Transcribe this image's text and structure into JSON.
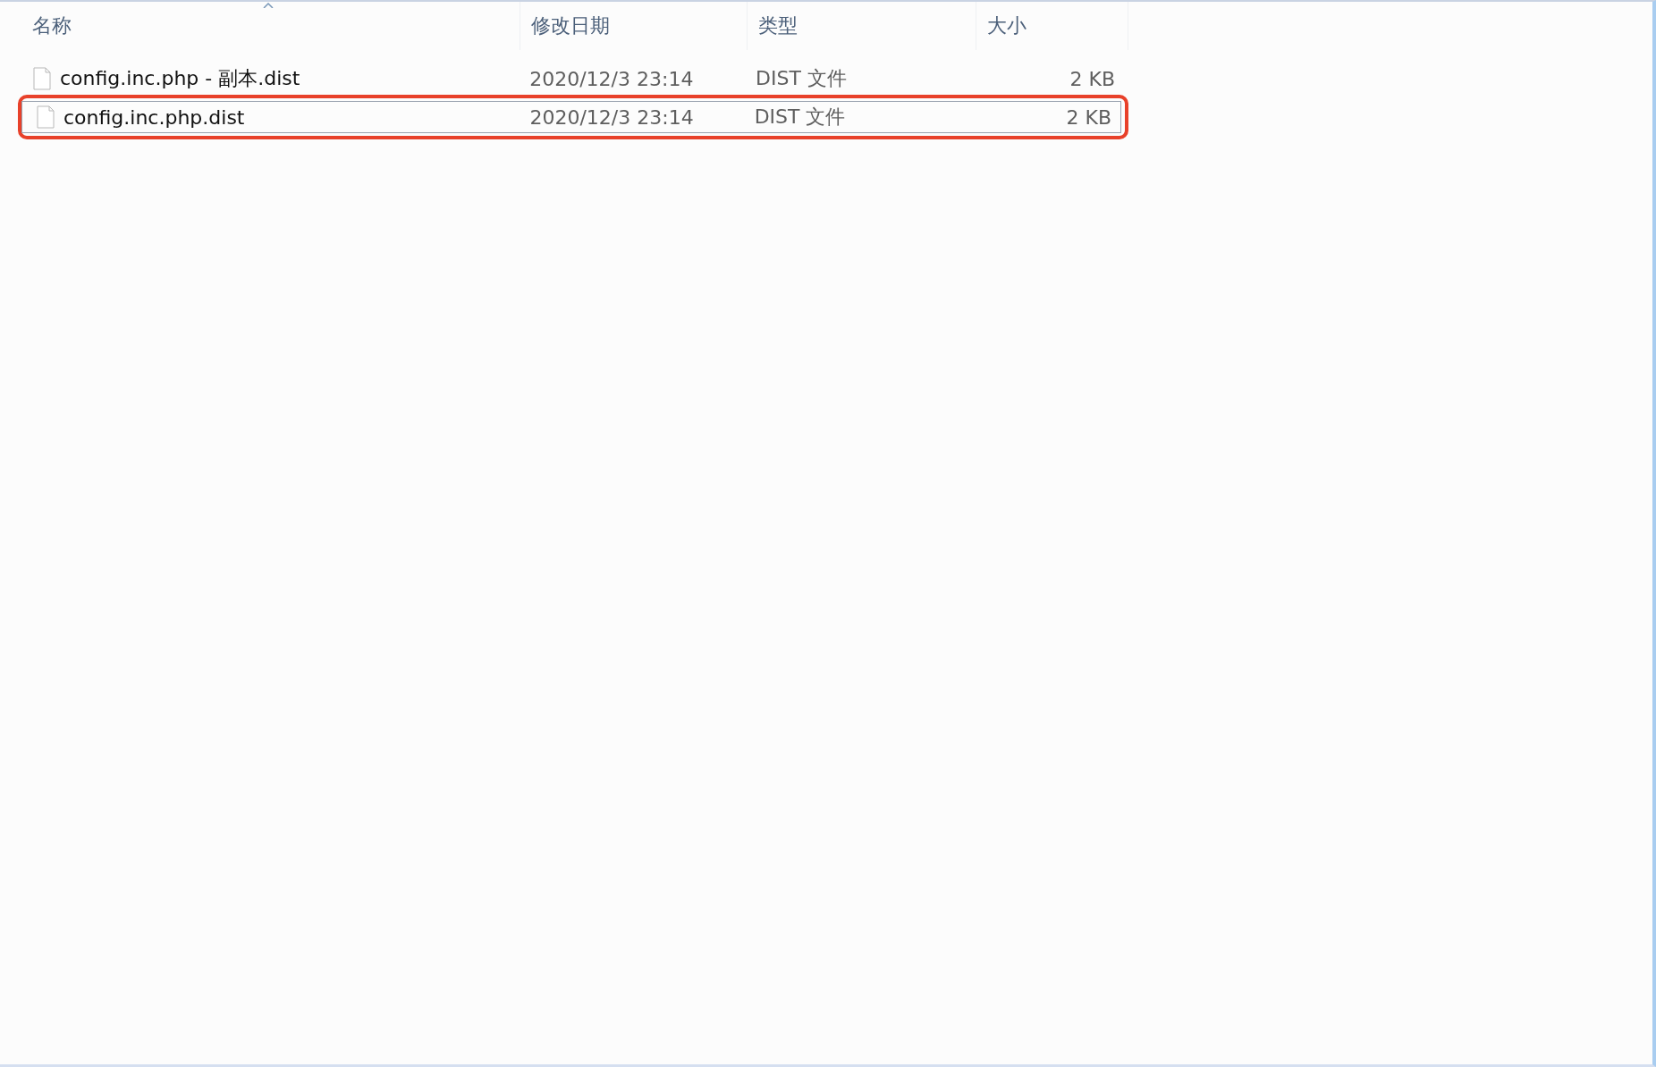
{
  "table": {
    "columns": [
      {
        "label": "名称",
        "sorted": true
      },
      {
        "label": "修改日期",
        "sorted": false
      },
      {
        "label": "类型",
        "sorted": false
      },
      {
        "label": "大小",
        "sorted": false
      }
    ],
    "rows": [
      {
        "name": "config.inc.php - 副本.dist",
        "modified": "2020/12/3 23:14",
        "type": "DIST 文件",
        "size": "2 KB",
        "selected": false,
        "annotated": false
      },
      {
        "name": "config.inc.php.dist",
        "modified": "2020/12/3 23:14",
        "type": "DIST 文件",
        "size": "2 KB",
        "selected": true,
        "annotated": true
      }
    ]
  }
}
